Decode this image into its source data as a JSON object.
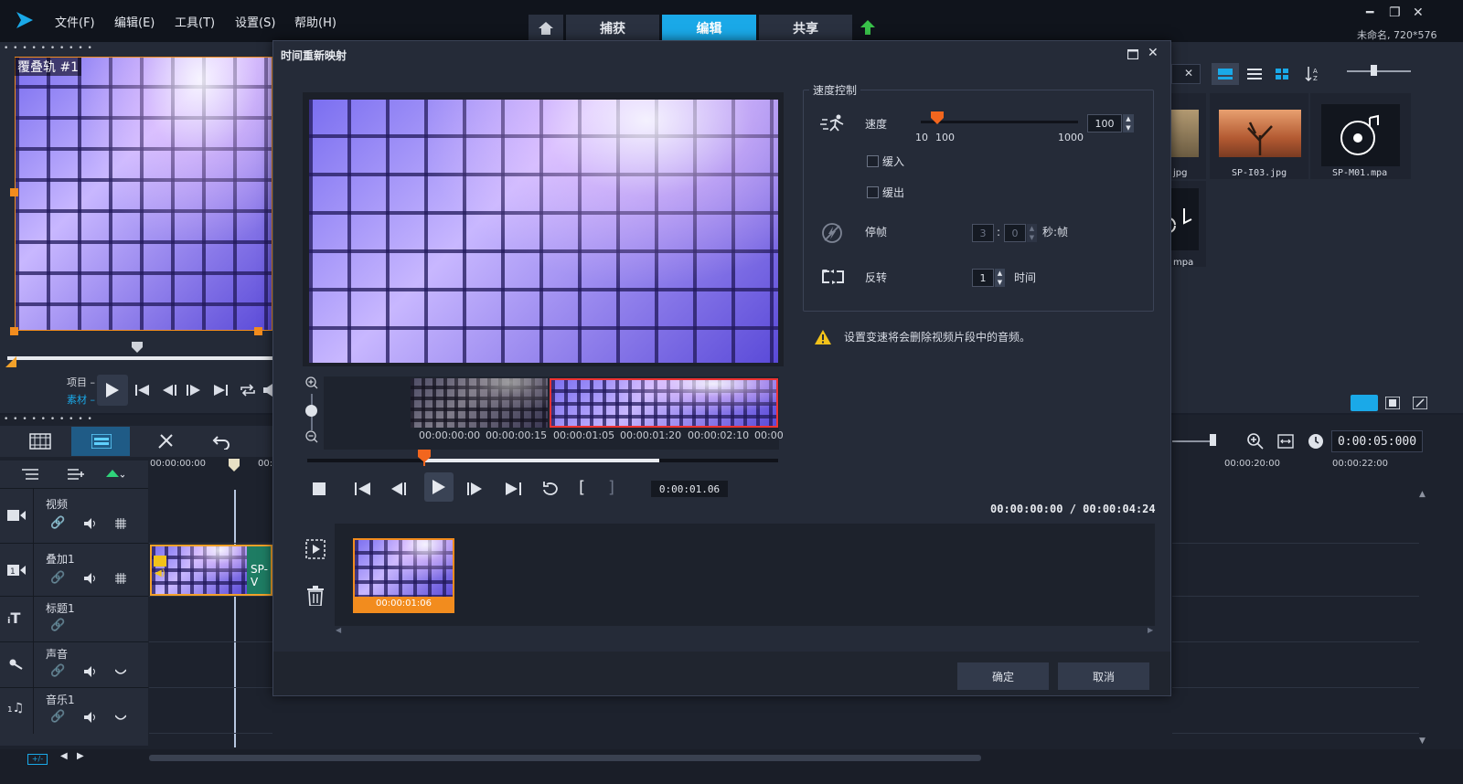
{
  "menu": {
    "file": "文件(F)",
    "edit": "编辑(E)",
    "tools": "工具(T)",
    "settings": "设置(S)",
    "help": "帮助(H)"
  },
  "nav_tabs": {
    "capture": "捕获",
    "edit": "编辑",
    "share": "共享"
  },
  "project_info": "未命名, 720*576",
  "preview": {
    "overlay_label": "覆叠轨 #1",
    "mode_project": "项目 –",
    "mode_clip": "素材 –"
  },
  "library": {
    "items": [
      {
        "name": "jpg"
      },
      {
        "name": "SP-I03.jpg"
      },
      {
        "name": "SP-M01.mpa"
      },
      {
        "name": "mpa"
      }
    ]
  },
  "timeline": {
    "ruler_start": "00:00:00:00",
    "ruler_partial": "00:",
    "ruler_mark1": "00:00:20:00",
    "ruler_mark2": "00:00:22:00",
    "duration": "0:00:05:000",
    "clip_label": "SP-V",
    "tracks": [
      {
        "name": "视频"
      },
      {
        "name": "叠加1"
      },
      {
        "name": "标题1"
      },
      {
        "name": "声音"
      },
      {
        "name": "音乐1"
      }
    ]
  },
  "dialog": {
    "title": "时间重新映射",
    "speed_group": "速度控制",
    "speed_label": "速度",
    "speed_value": "100",
    "speed_min": "10",
    "speed_mid": "100",
    "speed_max": "1000",
    "ease_in": "缓入",
    "ease_out": "缓出",
    "freeze_label": "停帧",
    "freeze_sec": "3",
    "freeze_sep": ":",
    "freeze_frame": "0",
    "freeze_unit": "秒:帧",
    "reverse_label": "反转",
    "reverse_value": "1",
    "reverse_unit": "时间",
    "warning": "设置变速将会删除视频片段中的音频。",
    "strip_times": [
      "00:00:00:00",
      "00:00:00:15",
      "00:00:01:05",
      "00:00:01:20",
      "00:00:02:10",
      "00:00"
    ],
    "current_tc": "0:00:01.06",
    "time_display": "00:00:00:00 / 00:00:04:24",
    "clip_time": "00:00:01:06",
    "ok": "确定",
    "cancel": "取消"
  },
  "colors": {
    "accent": "#1aa9e8",
    "orange": "#f28c1e",
    "panel": "#242a37"
  }
}
